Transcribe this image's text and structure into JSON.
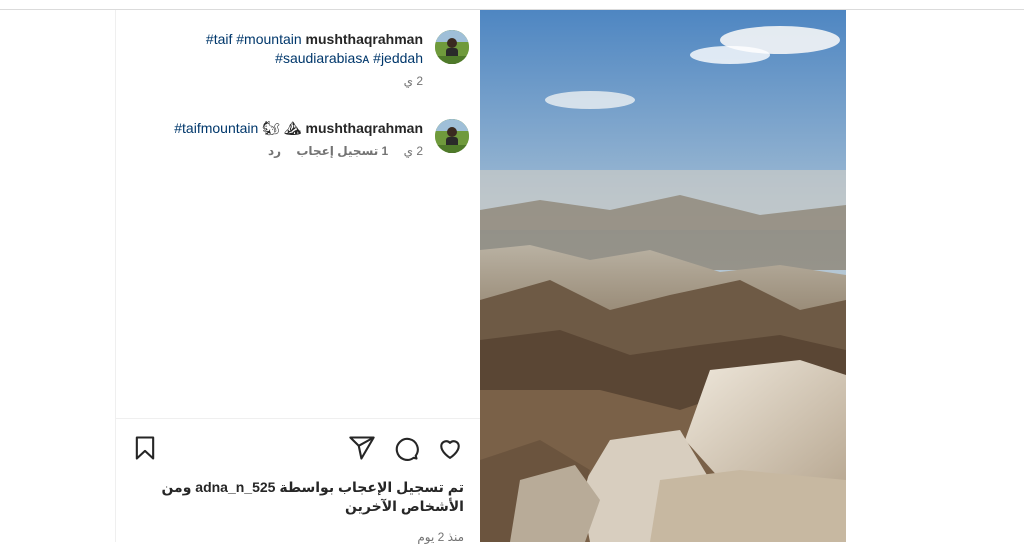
{
  "comments": [
    {
      "username": "mushthaqrahman",
      "tags_line1": "#taif #mountain",
      "tags_line2": "#saudiarabiaѕᴀ #jeddah",
      "time": "2 ي"
    },
    {
      "username": "mushthaqrahman",
      "emoji": "🐿 ⛰",
      "tags": "#taifmountain",
      "time": "2 ي",
      "likes": "1 تسجيل إعجاب",
      "reply": "رد"
    }
  ],
  "liked_by": {
    "prefix": "تم تسجيل الإعجاب بواسطة",
    "user": "adna_n_525",
    "suffix": "ومن الأشخاص الآخرين"
  },
  "posted_ago": "منذ 2 يوم",
  "icons": [
    "heart-icon",
    "comment-icon",
    "share-icon",
    "bookmark-icon"
  ]
}
